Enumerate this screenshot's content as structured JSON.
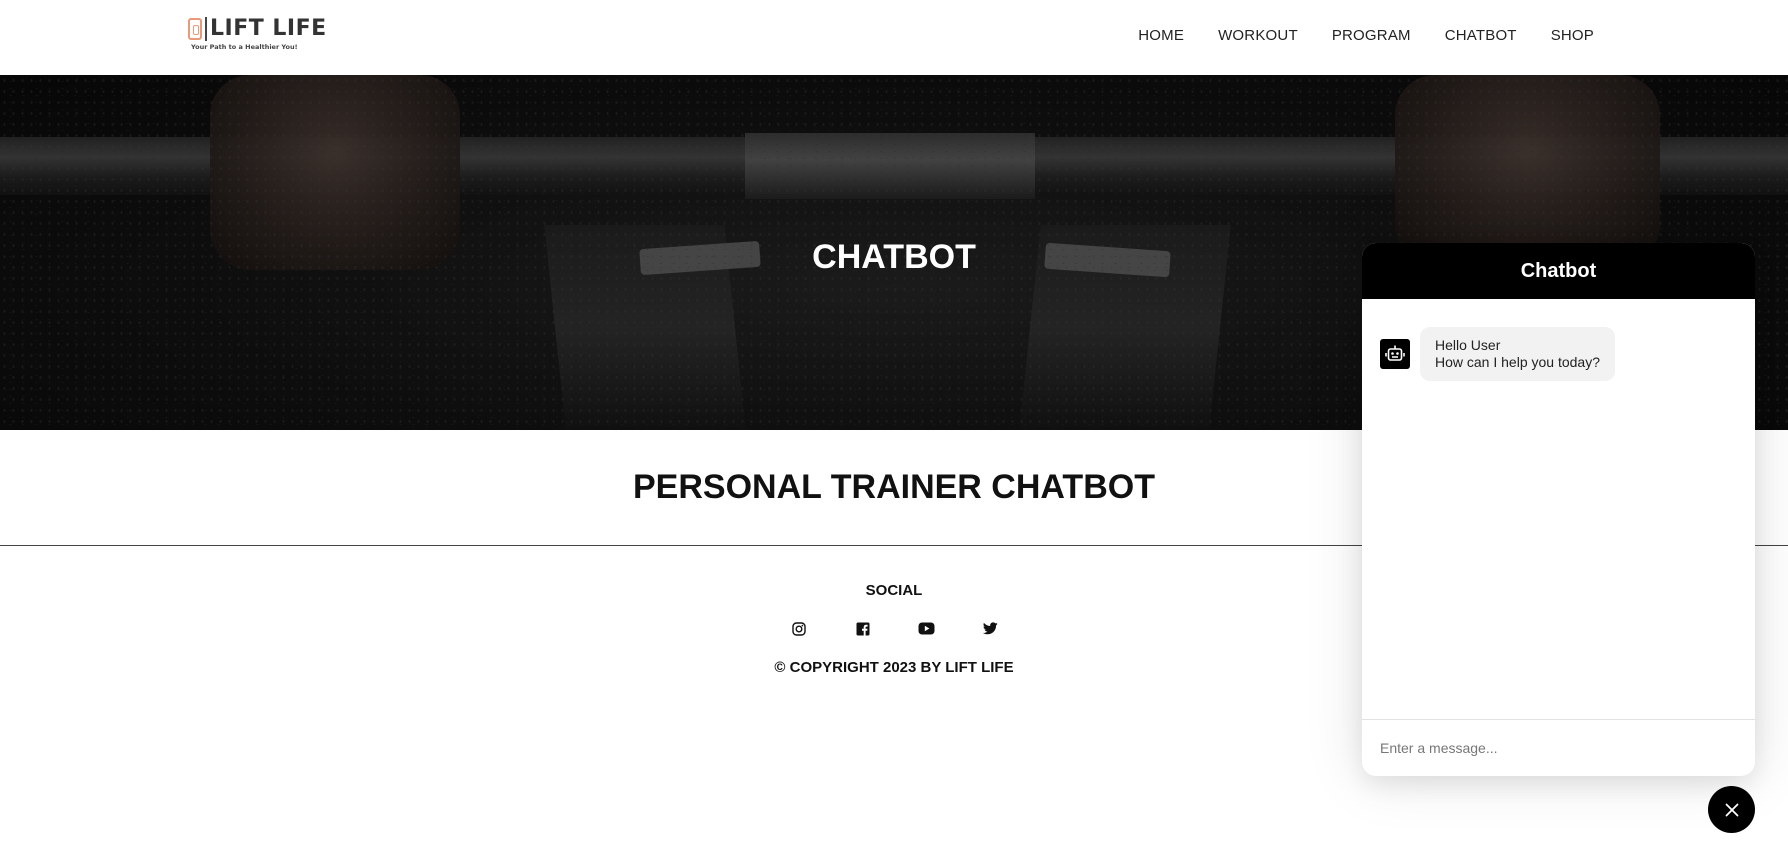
{
  "brand": {
    "name": "LIFT LIFE",
    "tagline": "Your Path to a Healthier You!",
    "accent_color": "#e89a7a"
  },
  "nav": {
    "items": [
      {
        "label": "HOME"
      },
      {
        "label": "WORKOUT"
      },
      {
        "label": "PROGRAM"
      },
      {
        "label": "CHATBOT"
      },
      {
        "label": "SHOP"
      }
    ]
  },
  "hero": {
    "title": "CHATBOT"
  },
  "main": {
    "title": "PERSONAL TRAINER CHATBOT"
  },
  "footer": {
    "social_title": "SOCIAL",
    "social_icons": [
      "instagram-icon",
      "facebook-icon",
      "youtube-icon",
      "twitter-icon"
    ],
    "copyright": "© COPYRIGHT 2023 BY LIFT LIFE"
  },
  "chat": {
    "title": "Chatbot",
    "messages": [
      {
        "sender": "bot",
        "lines": [
          "Hello User",
          "How can I help you today?"
        ]
      }
    ],
    "input_placeholder": "Enter a message...",
    "header_color": "#000000"
  }
}
